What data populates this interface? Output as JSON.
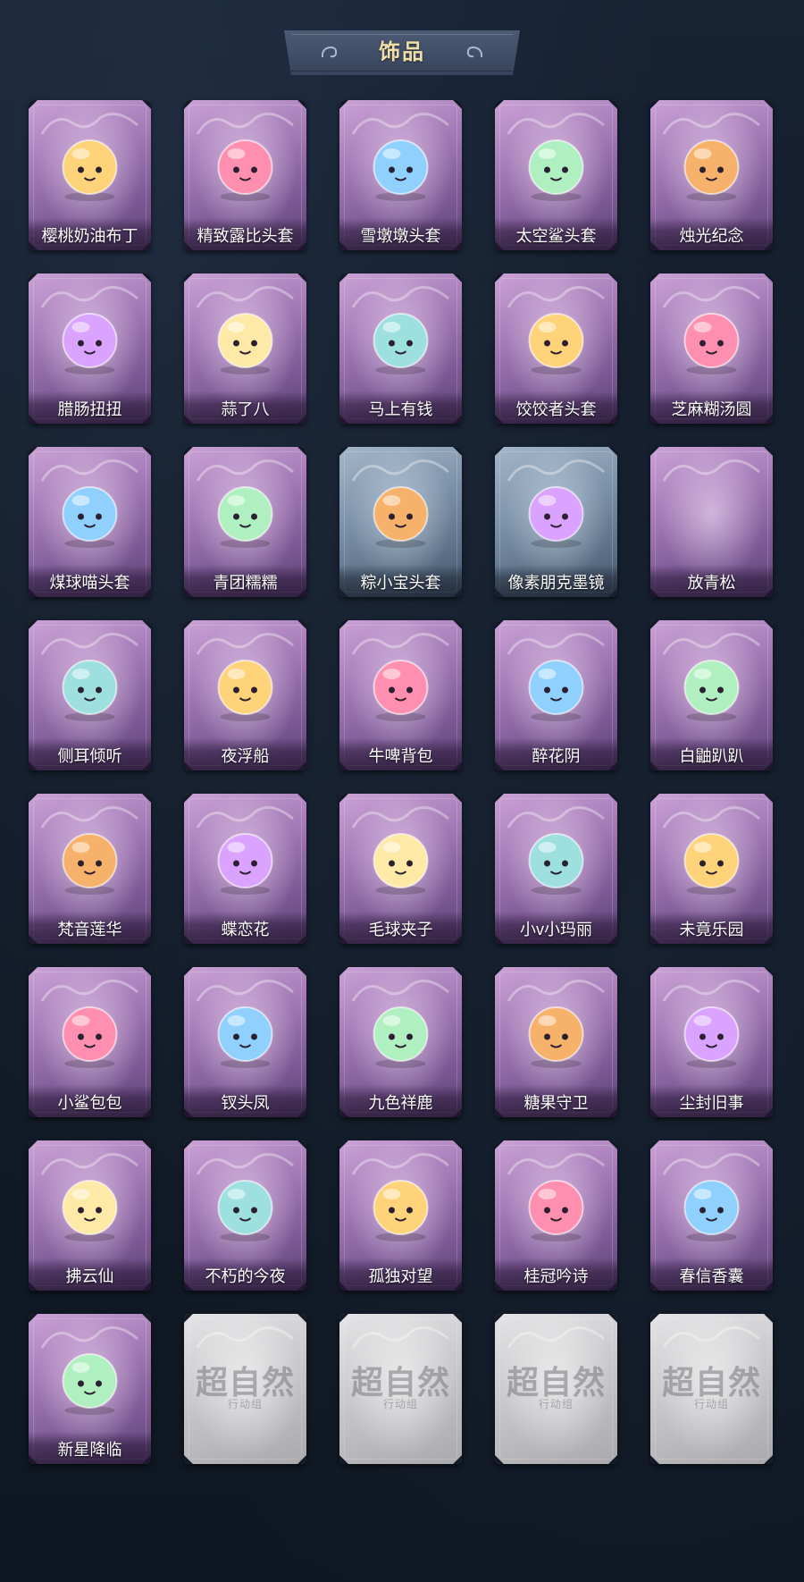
{
  "header": {
    "title": "饰品"
  },
  "colors": {
    "background": "#111a26",
    "card_purple": "#a67db8",
    "card_blue": "#7d93aa",
    "card_locked": "#c9c9cc",
    "title_gold": "#f0e0a8"
  },
  "items": [
    {
      "name": "樱桃奶油布丁",
      "style": "purple",
      "icon": "pudding-icon"
    },
    {
      "name": "精致露比头套",
      "style": "purple",
      "icon": "pink-bear-head-icon"
    },
    {
      "name": "雪墩墩头套",
      "style": "purple",
      "icon": "snowman-head-icon"
    },
    {
      "name": "太空鲨头套",
      "style": "purple",
      "icon": "shark-head-icon"
    },
    {
      "name": "烛光纪念",
      "style": "purple",
      "icon": "candle-icon"
    },
    {
      "name": "腊肠扭扭",
      "style": "purple",
      "icon": "dog-head-icon"
    },
    {
      "name": "蒜了八",
      "style": "purple",
      "icon": "garlic-icon"
    },
    {
      "name": "马上有钱",
      "style": "purple",
      "icon": "horse-head-icon"
    },
    {
      "name": "饺饺者头套",
      "style": "purple",
      "icon": "dumpling-head-icon"
    },
    {
      "name": "芝麻糊汤圆",
      "style": "purple",
      "icon": "rice-ball-icon"
    },
    {
      "name": "煤球喵头套",
      "style": "purple",
      "icon": "cat-head-icon"
    },
    {
      "name": "青团糯糯",
      "style": "purple",
      "icon": "green-rice-ball-icon"
    },
    {
      "name": "粽小宝头套",
      "style": "blue",
      "icon": "zongzi-head-icon"
    },
    {
      "name": "像素朋克墨镜",
      "style": "blue",
      "icon": "pixel-sunglasses-icon"
    },
    {
      "name": "放青松",
      "style": "purple",
      "icon": "empty-icon"
    },
    {
      "name": "侧耳倾听",
      "style": "purple",
      "icon": "lotus-ornament-icon"
    },
    {
      "name": "夜浮船",
      "style": "purple",
      "icon": "jellyfish-ornament-icon"
    },
    {
      "name": "牛啤背包",
      "style": "purple",
      "icon": "cow-mug-icon"
    },
    {
      "name": "醉花阴",
      "style": "purple",
      "icon": "flower-fan-icon"
    },
    {
      "name": "白鼬趴趴",
      "style": "purple",
      "icon": "white-ferret-icon"
    },
    {
      "name": "梵音莲华",
      "style": "purple",
      "icon": "lotus-doll-icon"
    },
    {
      "name": "蝶恋花",
      "style": "purple",
      "icon": "butterfly-bell-icon"
    },
    {
      "name": "毛球夹子",
      "style": "purple",
      "icon": "raccoon-drummer-icon"
    },
    {
      "name": "小v小玛丽",
      "style": "purple",
      "icon": "mary-doll-icon"
    },
    {
      "name": "未竟乐园",
      "style": "purple",
      "icon": "pink-hair-doll-icon"
    },
    {
      "name": "小鲨包包",
      "style": "purple",
      "icon": "shark-bag-icon"
    },
    {
      "name": "钗头凤",
      "style": "purple",
      "icon": "phoenix-crown-doll-icon"
    },
    {
      "name": "九色祥鹿",
      "style": "purple",
      "icon": "deer-charm-icon"
    },
    {
      "name": "糖果守卫",
      "style": "purple",
      "icon": "pumpkin-charm-icon"
    },
    {
      "name": "尘封旧事",
      "style": "purple",
      "icon": "gentleman-doll-icon"
    },
    {
      "name": "拂云仙",
      "style": "purple",
      "icon": "cloud-fairy-charm-icon"
    },
    {
      "name": "不朽的今夜",
      "style": "purple",
      "icon": "pink-fox-charm-icon"
    },
    {
      "name": "孤独对望",
      "style": "purple",
      "icon": "silver-doll-charm-icon"
    },
    {
      "name": "桂冠吟诗",
      "style": "purple",
      "icon": "laurel-doll-charm-icon"
    },
    {
      "name": "春信香囊",
      "style": "purple",
      "icon": "sachet-charm-icon"
    },
    {
      "name": "新星降临",
      "style": "purple",
      "icon": "star-doll-charm-icon"
    },
    {
      "name": "",
      "style": "gray",
      "icon": "locked-placeholder-icon",
      "watermark": "超自然",
      "watermark_sub": "行动组"
    },
    {
      "name": "",
      "style": "gray",
      "icon": "locked-placeholder-icon",
      "watermark": "超自然",
      "watermark_sub": "行动组"
    },
    {
      "name": "",
      "style": "gray",
      "icon": "locked-placeholder-icon",
      "watermark": "超自然",
      "watermark_sub": "行动组"
    },
    {
      "name": "",
      "style": "gray",
      "icon": "locked-placeholder-icon",
      "watermark": "超自然",
      "watermark_sub": "行动组"
    }
  ]
}
